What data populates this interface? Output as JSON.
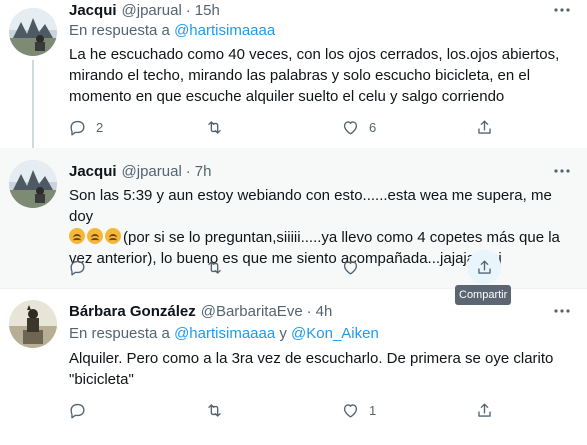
{
  "tweets": [
    {
      "name": "Jacqui",
      "handle": "@jparual",
      "time": "15h",
      "reply_prefix": "En respuesta a",
      "reply_to": [
        "@hartisimaaaa"
      ],
      "text": "La he escuchado como 40 veces, con los ojos cerrados, los.ojos abiertos, mirando el techo, mirando las palabras y solo escucho bicicleta, en el momento en que escuche alquiler suelto el celu y salgo corriendo",
      "replies": "2",
      "retweets": "",
      "likes": "6"
    },
    {
      "name": "Jacqui",
      "handle": "@jparual",
      "time": "7h",
      "text_part1": "Son las 5:39 y aun estoy webiando con esto......esta wea me supera, me doy",
      "text_part2": "(por si se lo preguntan,siiiii.....ya llevo como 4 copetes más que la vez anterior), lo bueno es que me siento acompañada...jajajajajaj",
      "emojis": [
        "disappointed-face",
        "disappointed-face",
        "disappointed-face"
      ],
      "replies": "",
      "retweets": "",
      "likes": ""
    },
    {
      "name": "Bárbara González",
      "handle": "@BarbaritaEve",
      "time": "4h",
      "reply_prefix": "En respuesta a",
      "reply_to": [
        "@hartisimaaaa",
        "@Kon_Aiken"
      ],
      "reply_conj": "y",
      "text": "Alquiler. Pero como a la 3ra vez de escucharlo. De primera se oye clarito \"bicicleta\"",
      "replies": "",
      "retweets": "",
      "likes": "1"
    }
  ],
  "separator": "·",
  "tooltip": "Compartir",
  "colors": {
    "accent": "#1d9bf0",
    "secondary_text": "#536471",
    "hover_bg": "#f7f9f9"
  }
}
